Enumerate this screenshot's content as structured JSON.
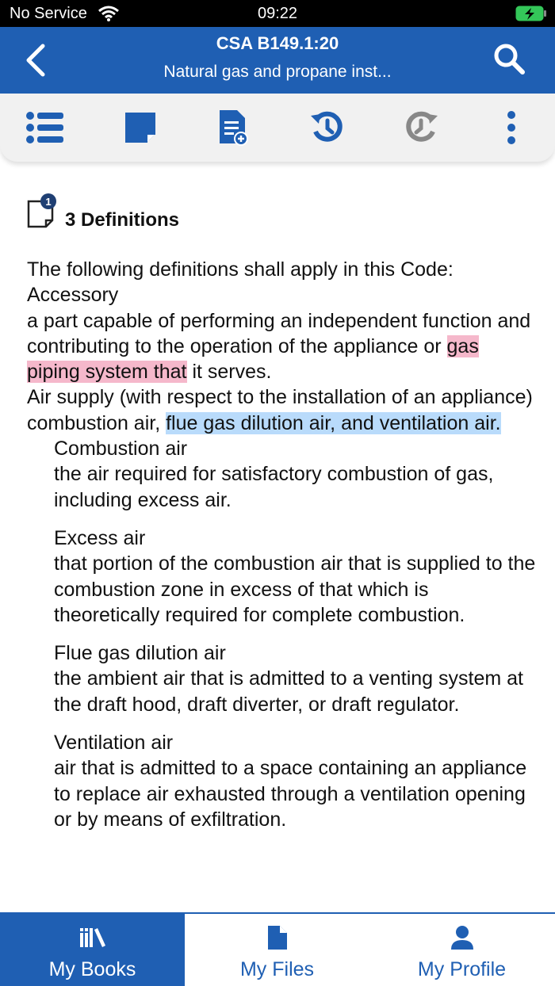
{
  "status_bar": {
    "carrier": "No Service",
    "time": "09:22",
    "wifi_icon": "wifi-icon",
    "battery_icon": "battery-charging-icon"
  },
  "header": {
    "title": "CSA B149.1:20",
    "subtitle": "Natural gas and propane inst...",
    "back_icon": "chevron-left-icon",
    "search_icon": "search-icon",
    "color": "#1f5fb3"
  },
  "toolbar": {
    "items": [
      {
        "icon": "list-icon"
      },
      {
        "icon": "note-icon"
      },
      {
        "icon": "add-document-icon"
      },
      {
        "icon": "history-back-icon"
      },
      {
        "icon": "history-forward-icon"
      },
      {
        "icon": "more-vertical-icon"
      }
    ]
  },
  "section": {
    "note_count": "1",
    "title": "3 Definitions",
    "intro": "The following definitions shall apply in this Code:",
    "term1": "Accessory",
    "def1_before": "a part capable of performing an independent function and contributing to the operation of the appliance or ",
    "def1_highlight": "gas piping system that",
    "def1_after": " it serves.",
    "term2": "Air supply (with respect to the installation of an appliance)",
    "def2_before": "combustion air, ",
    "def2_highlight": "flue gas dilution air, and ventilation air.",
    "highlight_pink": "#f5b8cb",
    "highlight_blue": "#b9dbfb",
    "sub_entries": [
      {
        "term": "Combustion air",
        "definition": "the air required for satisfactory combustion of gas, including excess air."
      },
      {
        "term": "Excess air",
        "definition": "that portion of the combustion air that is supplied to the combustion zone in excess of that which is theoretically required for complete combustion."
      },
      {
        "term": "Flue gas dilution air",
        "definition": "the ambient air that is admitted to a venting system at the draft hood, draft diverter, or draft regulator."
      },
      {
        "term": "Ventilation air",
        "definition": "air that is admitted to a space containing an appliance to replace air exhausted through a ventilation opening or by means of exfiltration."
      }
    ]
  },
  "bottom_nav": {
    "items": [
      {
        "label": "My Books",
        "icon": "books-icon",
        "active": true
      },
      {
        "label": "My Files",
        "icon": "file-icon",
        "active": false
      },
      {
        "label": "My Profile",
        "icon": "person-icon",
        "active": false
      }
    ]
  }
}
